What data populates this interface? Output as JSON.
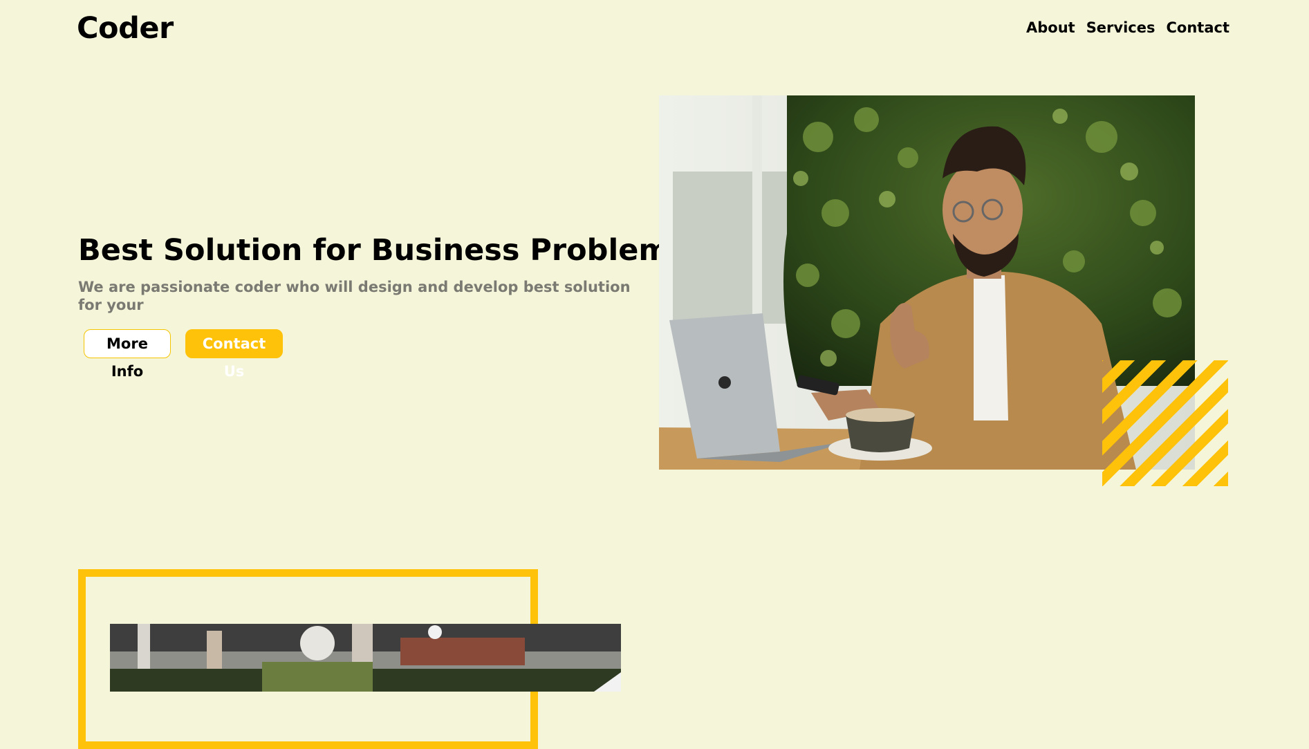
{
  "header": {
    "logo": "Coder",
    "nav": [
      {
        "label": "About"
      },
      {
        "label": "Services"
      },
      {
        "label": "Contact"
      }
    ]
  },
  "hero": {
    "title": "Best Solution for Business Problem",
    "subtitle": "We are passionate coder who will design and develop best solution for your",
    "buttons": {
      "more_info": "More Info",
      "contact_us": "Contact Us"
    },
    "image_alt": "man with laptop and coffee giving thumbs up"
  },
  "colors": {
    "background": "#f5f5da",
    "accent": "#fec20b",
    "muted_text": "#7a7a72"
  }
}
